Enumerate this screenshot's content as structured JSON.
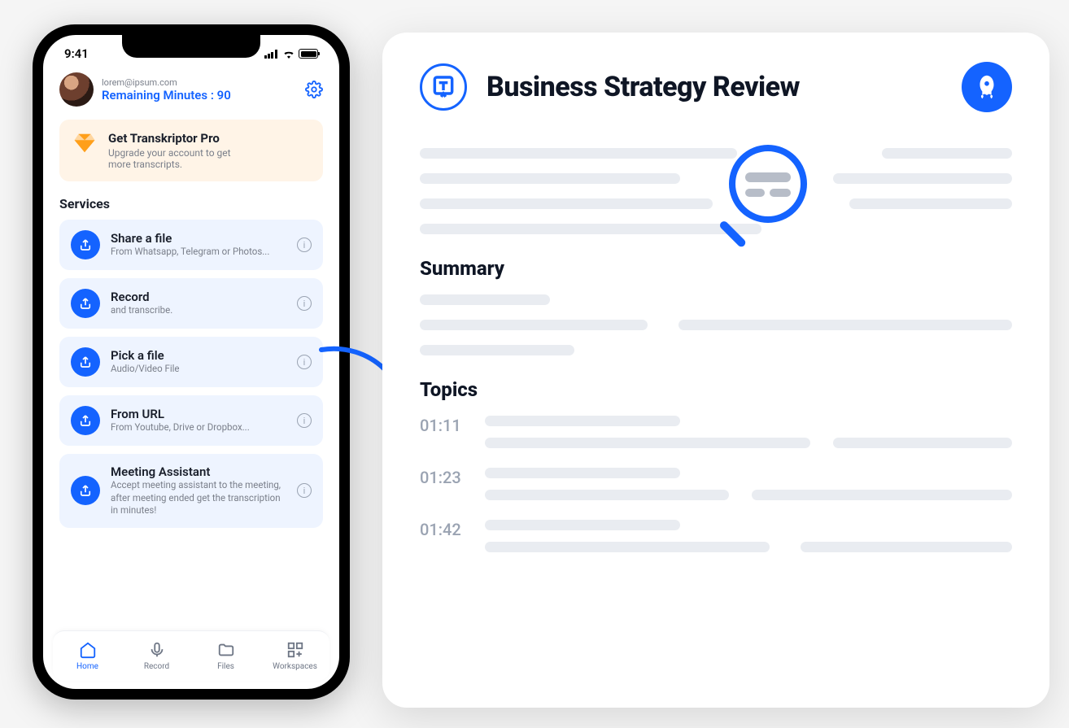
{
  "phone": {
    "clock": "9:41",
    "user": {
      "email": "lorem@ipsum.com",
      "remaining_label": "Remaining Minutes : ",
      "remaining_value": "90"
    },
    "promo": {
      "title": "Get Transkriptor Pro",
      "subtitle": "Upgrade your account to get more transcripts."
    },
    "services_heading": "Services",
    "services": [
      {
        "title": "Share a file",
        "subtitle": "From Whatsapp, Telegram or Photos..."
      },
      {
        "title": "Record",
        "subtitle": "and transcribe."
      },
      {
        "title": "Pick a file",
        "subtitle": "Audio/Video File"
      },
      {
        "title": "From URL",
        "subtitle": "From Youtube, Drive or Dropbox..."
      },
      {
        "title": "Meeting Assistant",
        "subtitle": "Accept meeting assistant to the meeting, after meeting ended get the transcription in minutes!"
      }
    ],
    "tabs": [
      {
        "label": "Home"
      },
      {
        "label": "Record"
      },
      {
        "label": "Files"
      },
      {
        "label": "Workspaces"
      }
    ]
  },
  "panel": {
    "title": "Business Strategy Review",
    "summary_heading": "Summary",
    "topics_heading": "Topics",
    "topics": [
      {
        "time": "01:11"
      },
      {
        "time": "01:23"
      },
      {
        "time": "01:42"
      }
    ]
  },
  "colors": {
    "accent": "#1463ff"
  }
}
